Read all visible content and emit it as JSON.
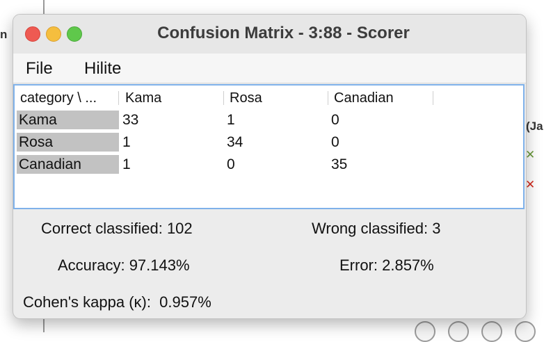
{
  "window": {
    "title": "Confusion Matrix - 3:88 - Scorer"
  },
  "menu": [
    "File",
    "Hilite"
  ],
  "matrix": {
    "corner": "category \\ ...",
    "columns": [
      "Kama",
      "Rosa",
      "Canadian"
    ],
    "rows": [
      {
        "label": "Kama",
        "values": [
          "33",
          "1",
          "0"
        ]
      },
      {
        "label": "Rosa",
        "values": [
          "1",
          "34",
          "0"
        ]
      },
      {
        "label": "Canadian",
        "values": [
          "1",
          "0",
          "35"
        ]
      }
    ]
  },
  "stats": {
    "correct": "Correct classified: 102",
    "wrong": "Wrong classified: 3",
    "accuracy": "Accuracy: 97.143%",
    "error": "Error: 2.857%",
    "kappa": "Cohen's kappa (κ):  0.957%"
  },
  "background": {
    "label_fragment": "(Ja",
    "left_fragment": "n"
  },
  "colors": {
    "selection_border": "#7fb1ea",
    "row_header_bg": "#c2c2c2",
    "close": "#ee5a52",
    "minimize": "#f5be3e",
    "maximize": "#5fc84b"
  }
}
